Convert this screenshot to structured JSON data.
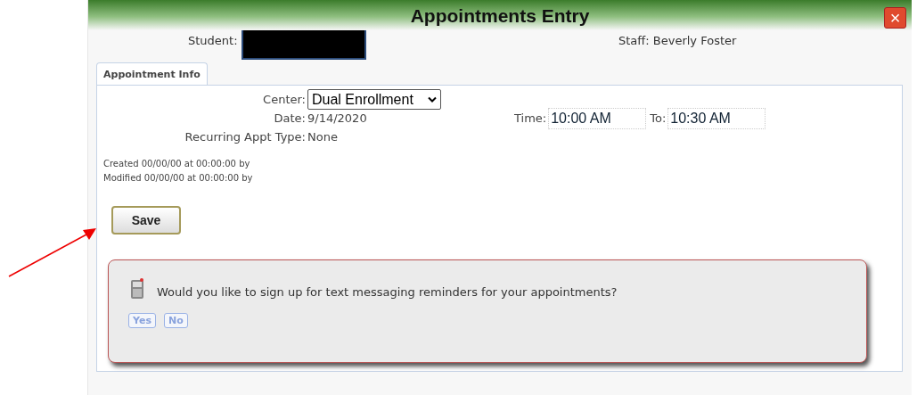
{
  "window": {
    "title": "Appointments Entry",
    "close": "×"
  },
  "header": {
    "student": {
      "label": "Student:",
      "redacted": true
    },
    "staff": "Staff: Beverly Foster"
  },
  "tabs": [
    {
      "label": "Appointment Info",
      "selected": true
    }
  ],
  "form": {
    "center": {
      "label": "Center:",
      "value": "Dual Enrollment"
    },
    "date": {
      "label": "Date:",
      "value": "9/14/2020"
    },
    "recurring": {
      "label": "Recurring Appt Type:",
      "value": "None"
    },
    "time": {
      "label": "Time:",
      "value": "10:00 AM"
    },
    "to": {
      "label": "To:",
      "value": "10:30 AM"
    }
  },
  "audit": [
    "Created 00/00/00 at 00:00:00 by",
    "Modified 00/00/00 at 00:00:00 by"
  ],
  "save_button": "Save",
  "reminder": {
    "prompt": "Would you like to sign up for text messaging reminders for your appointments?",
    "buttons": [
      "Yes",
      "No"
    ]
  },
  "annotation": {
    "kind": "arrow"
  }
}
